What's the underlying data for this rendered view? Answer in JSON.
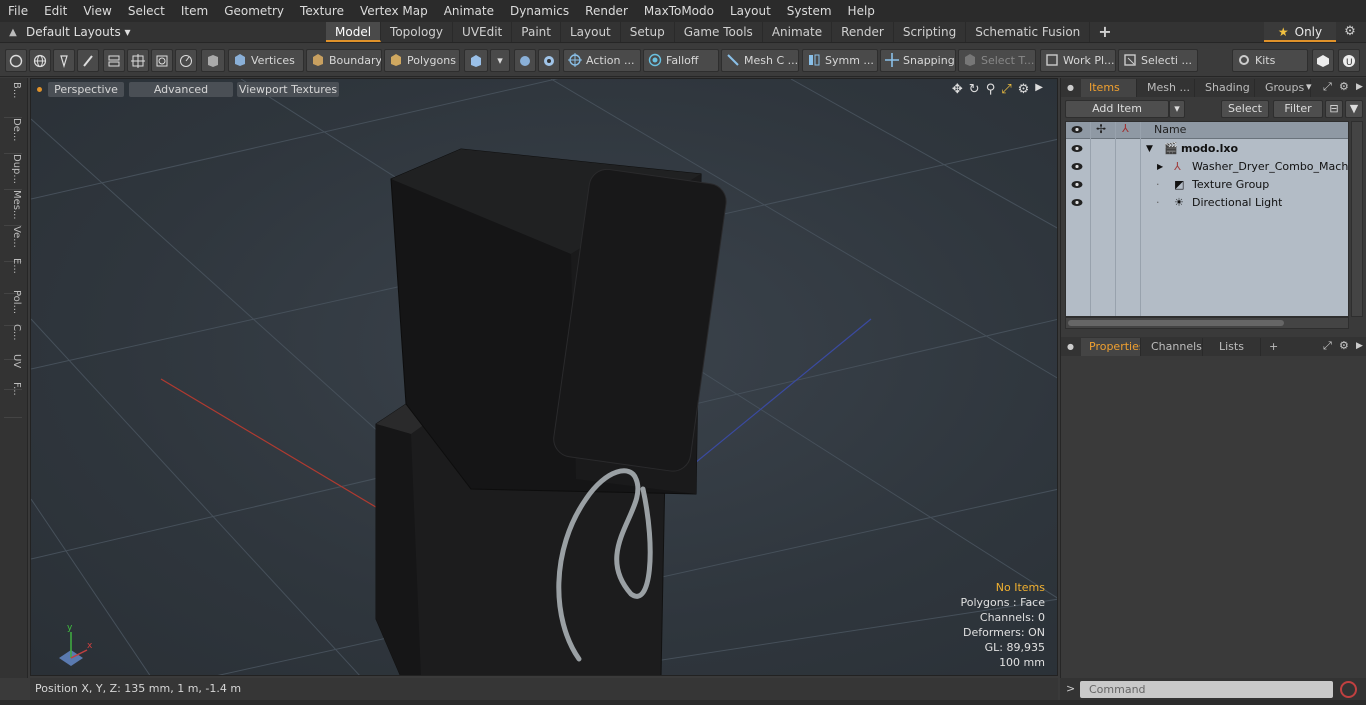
{
  "menu": [
    "File",
    "Edit",
    "View",
    "Select",
    "Item",
    "Geometry",
    "Texture",
    "Vertex Map",
    "Animate",
    "Dynamics",
    "Render",
    "MaxToModo",
    "Layout",
    "System",
    "Help"
  ],
  "layouts": {
    "label": "Default Layouts ▾"
  },
  "tabs": [
    {
      "label": "Model",
      "active": true
    },
    {
      "label": "Topology"
    },
    {
      "label": "UVEdit"
    },
    {
      "label": "Paint"
    },
    {
      "label": "Layout"
    },
    {
      "label": "Setup"
    },
    {
      "label": "Game Tools"
    },
    {
      "label": "Animate"
    },
    {
      "label": "Render"
    },
    {
      "label": "Scripting"
    },
    {
      "label": "Schematic Fusion"
    }
  ],
  "tab_add": "+",
  "only": {
    "label": "Only"
  },
  "toolbar": {
    "vertices": "Vertices",
    "boundary": "Boundary",
    "polygons": "Polygons",
    "action": "Action ...",
    "falloff": "Falloff",
    "mesh_c": "Mesh C ...",
    "symm": "Symm ...",
    "snapping": "Snapping",
    "select_t": "Select T...",
    "work_pl": "Work Pl...",
    "selecti": "Selecti ...",
    "kits": "Kits"
  },
  "sidetabs": [
    "B...",
    "De...",
    "Dup...",
    "Mes...",
    "Ve...",
    "E...",
    "Pol...",
    "C...",
    "UV",
    "F..."
  ],
  "viewport": {
    "perspective": "Perspective",
    "advanced": "Advanced",
    "textures": "Viewport Textures",
    "stats": {
      "items": "No Items",
      "polygons": "Polygons : Face",
      "channels": "Channels: 0",
      "deformers": "Deformers: ON",
      "gl": "GL: 89,935",
      "scale": "100 mm"
    },
    "axis_x": "x",
    "axis_y": "y"
  },
  "position": "Position X, Y, Z:   135 mm, 1 m, -1.4 m",
  "right_panel": {
    "tabs": [
      "Items",
      "Mesh ...",
      "Shading",
      "Groups"
    ],
    "add_item": "Add Item",
    "select": "Select",
    "filter": "Filter",
    "name_col": "Name",
    "tree": [
      {
        "label": "modo.lxo",
        "bold": true
      },
      {
        "label": "Washer_Dryer_Combo_Machi..."
      },
      {
        "label": "Texture Group"
      },
      {
        "label": "Directional Light"
      }
    ],
    "lower_tabs": [
      "Properties",
      "Channels",
      "Lists"
    ],
    "lower_add": "+"
  },
  "command": {
    "placeholder": "Command",
    "prompt": ">"
  },
  "colors": {
    "accent": "#e0922a",
    "stats_highlight": "#f0b030"
  }
}
